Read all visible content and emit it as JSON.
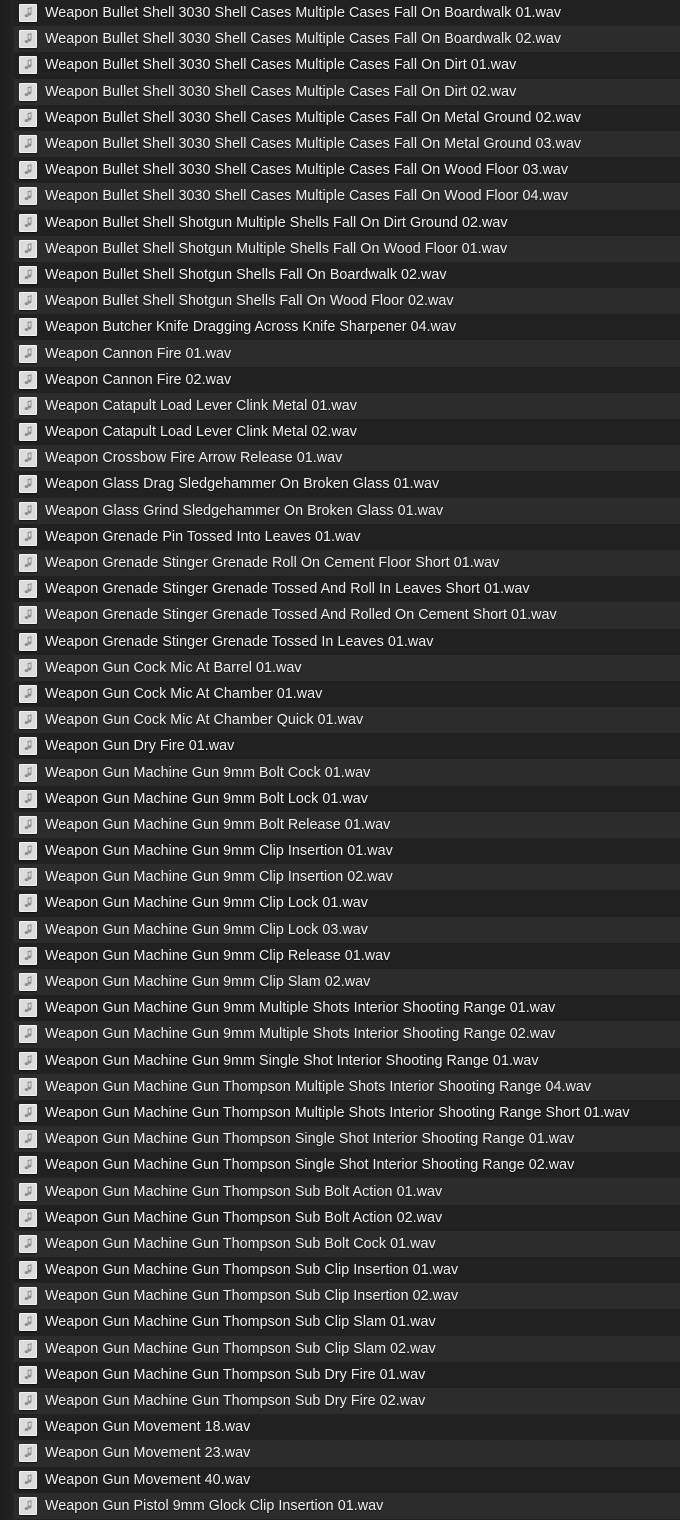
{
  "window": {
    "title": "Sound File Browser",
    "background_color": "#232323",
    "row_color_odd": "#212121",
    "row_color_even": "#2c2c2c",
    "text_color": "#f0f0f0",
    "icon_color": "#dcdcdc"
  },
  "icon": {
    "name": "audio-file-icon",
    "glyph": "music-note"
  },
  "files": [
    {
      "name": "Weapon Bullet Shell 3030 Shell Cases Multiple Cases Fall On Boardwalk 01.wav"
    },
    {
      "name": "Weapon Bullet Shell 3030 Shell Cases Multiple Cases Fall On Boardwalk 02.wav"
    },
    {
      "name": "Weapon Bullet Shell 3030 Shell Cases Multiple Cases Fall On Dirt 01.wav"
    },
    {
      "name": "Weapon Bullet Shell 3030 Shell Cases Multiple Cases Fall On Dirt 02.wav"
    },
    {
      "name": "Weapon Bullet Shell 3030 Shell Cases Multiple Cases Fall On Metal Ground 02.wav"
    },
    {
      "name": "Weapon Bullet Shell 3030 Shell Cases Multiple Cases Fall On Metal Ground 03.wav"
    },
    {
      "name": "Weapon Bullet Shell 3030 Shell Cases Multiple Cases Fall On Wood Floor 03.wav"
    },
    {
      "name": "Weapon Bullet Shell 3030 Shell Cases Multiple Cases Fall On Wood Floor 04.wav"
    },
    {
      "name": "Weapon Bullet Shell Shotgun Multiple Shells Fall On Dirt Ground 02.wav"
    },
    {
      "name": "Weapon Bullet Shell Shotgun Multiple Shells Fall On Wood Floor 01.wav"
    },
    {
      "name": "Weapon Bullet Shell Shotgun Shells Fall On Boardwalk 02.wav"
    },
    {
      "name": "Weapon Bullet Shell Shotgun Shells Fall On Wood Floor 02.wav"
    },
    {
      "name": "Weapon Butcher Knife Dragging Across Knife Sharpener 04.wav"
    },
    {
      "name": "Weapon Cannon Fire 01.wav"
    },
    {
      "name": "Weapon Cannon Fire 02.wav"
    },
    {
      "name": "Weapon Catapult Load Lever Clink Metal 01.wav"
    },
    {
      "name": "Weapon Catapult Load Lever Clink Metal 02.wav"
    },
    {
      "name": "Weapon Crossbow Fire Arrow Release 01.wav"
    },
    {
      "name": "Weapon Glass Drag Sledgehammer On Broken Glass 01.wav"
    },
    {
      "name": "Weapon Glass Grind Sledgehammer On Broken Glass 01.wav"
    },
    {
      "name": "Weapon Grenade Pin Tossed Into Leaves 01.wav"
    },
    {
      "name": "Weapon Grenade Stinger Grenade Roll On Cement Floor Short 01.wav"
    },
    {
      "name": "Weapon Grenade Stinger Grenade Tossed And Roll In Leaves Short 01.wav"
    },
    {
      "name": "Weapon Grenade Stinger Grenade Tossed And Rolled On Cement Short 01.wav"
    },
    {
      "name": "Weapon Grenade Stinger Grenade Tossed In Leaves 01.wav"
    },
    {
      "name": "Weapon Gun Cock Mic At Barrel 01.wav"
    },
    {
      "name": "Weapon Gun Cock Mic At Chamber 01.wav"
    },
    {
      "name": "Weapon Gun Cock Mic At Chamber Quick 01.wav"
    },
    {
      "name": "Weapon Gun Dry Fire 01.wav"
    },
    {
      "name": "Weapon Gun Machine Gun 9mm Bolt Cock 01.wav"
    },
    {
      "name": "Weapon Gun Machine Gun 9mm Bolt Lock 01.wav"
    },
    {
      "name": "Weapon Gun Machine Gun 9mm Bolt Release 01.wav"
    },
    {
      "name": "Weapon Gun Machine Gun 9mm Clip Insertion 01.wav"
    },
    {
      "name": "Weapon Gun Machine Gun 9mm Clip Insertion 02.wav"
    },
    {
      "name": "Weapon Gun Machine Gun 9mm Clip Lock 01.wav"
    },
    {
      "name": "Weapon Gun Machine Gun 9mm Clip Lock 03.wav"
    },
    {
      "name": "Weapon Gun Machine Gun 9mm Clip Release 01.wav"
    },
    {
      "name": "Weapon Gun Machine Gun 9mm Clip Slam 02.wav"
    },
    {
      "name": "Weapon Gun Machine Gun 9mm Multiple Shots Interior Shooting Range 01.wav"
    },
    {
      "name": "Weapon Gun Machine Gun 9mm Multiple Shots Interior Shooting Range 02.wav"
    },
    {
      "name": "Weapon Gun Machine Gun 9mm Single Shot Interior Shooting Range 01.wav"
    },
    {
      "name": "Weapon Gun Machine Gun Thompson Multiple Shots Interior Shooting Range 04.wav"
    },
    {
      "name": "Weapon Gun Machine Gun Thompson Multiple Shots Interior Shooting Range Short  01.wav"
    },
    {
      "name": "Weapon Gun Machine Gun Thompson Single Shot Interior Shooting Range 01.wav"
    },
    {
      "name": "Weapon Gun Machine Gun Thompson Single Shot Interior Shooting Range 02.wav"
    },
    {
      "name": "Weapon Gun Machine Gun Thompson Sub Bolt Action 01.wav"
    },
    {
      "name": "Weapon Gun Machine Gun Thompson Sub Bolt Action 02.wav"
    },
    {
      "name": "Weapon Gun Machine Gun Thompson Sub Bolt Cock 01.wav"
    },
    {
      "name": "Weapon Gun Machine Gun Thompson Sub Clip Insertion 01.wav"
    },
    {
      "name": "Weapon Gun Machine Gun Thompson Sub Clip Insertion 02.wav"
    },
    {
      "name": "Weapon Gun Machine Gun Thompson Sub Clip Slam 01.wav"
    },
    {
      "name": "Weapon Gun Machine Gun Thompson Sub Clip Slam 02.wav"
    },
    {
      "name": "Weapon Gun Machine Gun Thompson Sub Dry Fire 01.wav"
    },
    {
      "name": "Weapon Gun Machine Gun Thompson Sub Dry Fire 02.wav"
    },
    {
      "name": "Weapon Gun Movement 18.wav"
    },
    {
      "name": "Weapon Gun Movement 23.wav"
    },
    {
      "name": "Weapon Gun Movement 40.wav"
    },
    {
      "name": "Weapon Gun Pistol 9mm Glock Clip Insertion 01.wav"
    }
  ]
}
